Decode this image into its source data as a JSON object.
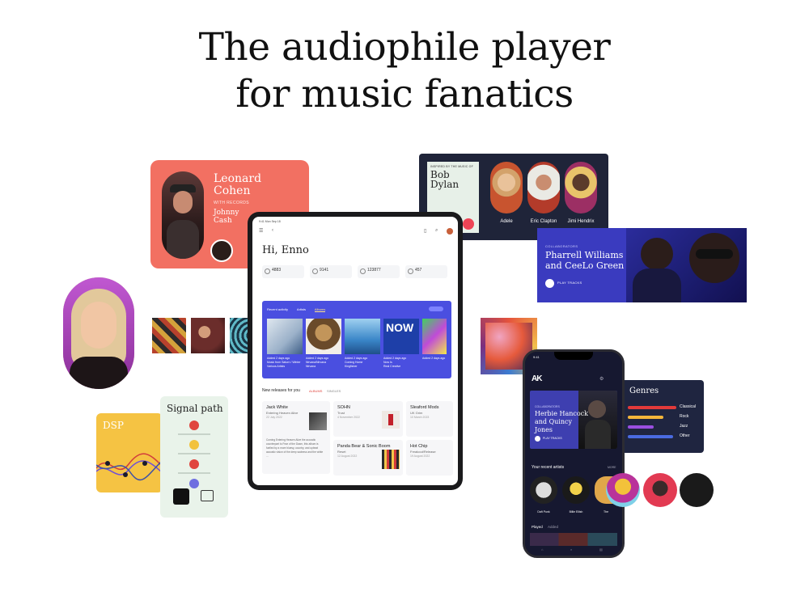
{
  "headline": {
    "line1": "The audiophile player",
    "line2": "for music fanatics"
  },
  "leonard_card": {
    "name": "Leonard Cohen",
    "label": "WITH RECORDS",
    "name2": "Johnny Cash"
  },
  "dylan_card": {
    "label": "INSPIRED BY THE MUSIC OF",
    "name": "Bob Dylan",
    "artists": [
      {
        "name": "Adele"
      },
      {
        "name": "Eric Clapton"
      },
      {
        "name": "Jimi Hendrix"
      }
    ]
  },
  "pharrell_card": {
    "label": "COLLABORATORS",
    "name": "Pharrell Williams and CeeLo Green",
    "play": "PLAY TRACKS"
  },
  "dsp_card": {
    "title": "DSP"
  },
  "signal_card": {
    "title": "Signal path"
  },
  "tablet": {
    "status": "9:41 Mon Sep 18",
    "greeting": "Hi, Enno",
    "stats": [
      {
        "value": "4883"
      },
      {
        "value": "9141"
      },
      {
        "value": "123877"
      },
      {
        "value": "457"
      }
    ],
    "recent": {
      "tabs": [
        "Recent activity",
        "Artists",
        "Albums"
      ],
      "items": [
        {
          "line1": "Added 2 days ago",
          "line2": "Music from Saturn / Winter",
          "line3": "Various Artists"
        },
        {
          "line1": "Added 2 days ago",
          "line2": "Nirvana/Nirvana",
          "line3": "Nirvana"
        },
        {
          "line1": "Added 2 days ago",
          "line2": "Coming Home",
          "line3": "Kingfisher"
        },
        {
          "line1": "Added 2 days ago",
          "line2": "Now Is",
          "line3": "Real Creative"
        },
        {
          "line1": "Added 2 days ago",
          "line2": "",
          "line3": ""
        }
      ]
    },
    "new_releases": {
      "title": "New releases for you",
      "tabs": [
        "ALBUMS",
        "SINGLES"
      ]
    },
    "cards": [
      {
        "title": "Jack White",
        "sub": "Entering Heaven Alive",
        "date": "22 July 2022"
      },
      {
        "title": "SOHN",
        "sub": "Trust",
        "date": "4 November 2022"
      },
      {
        "title": "Sleaford Mods",
        "sub": "UK Grim",
        "date": "10 March 2023"
      },
      {
        "title": "Panda Bear & Sonic Boom",
        "sub": "Reset",
        "date": "12 August 2022"
      },
      {
        "title": "Hot Chip",
        "sub": "Freakout/Release",
        "date": "19 August 2022"
      }
    ],
    "card_body": "Coming Entering Heaven Alive the acoustic counterpart to Fear of the Dawn, this album is fuelled by a more bluesy, country, and upbeat acoustic vision of the deep sadness and the white ..."
  },
  "phone": {
    "time": "9:41",
    "logo": "AK",
    "feature_label": "COLLABORATORS",
    "feature_name": "Herbie Hancock and Quincy Jones",
    "feature_play": "PLAY TRACKS",
    "your_recent_artists": "Your recent artists",
    "more": "MORE",
    "artists": [
      "Daft Punk",
      "Billie Eilish",
      "The"
    ],
    "played": "Played",
    "added": "Added"
  },
  "genres": {
    "title": "Genres",
    "items": [
      "Classical",
      "Rock",
      "Jazz",
      "Other"
    ]
  },
  "colors": {
    "accent": "#4a4fe0",
    "coral": "#f27062",
    "navy": "#1f2439"
  }
}
